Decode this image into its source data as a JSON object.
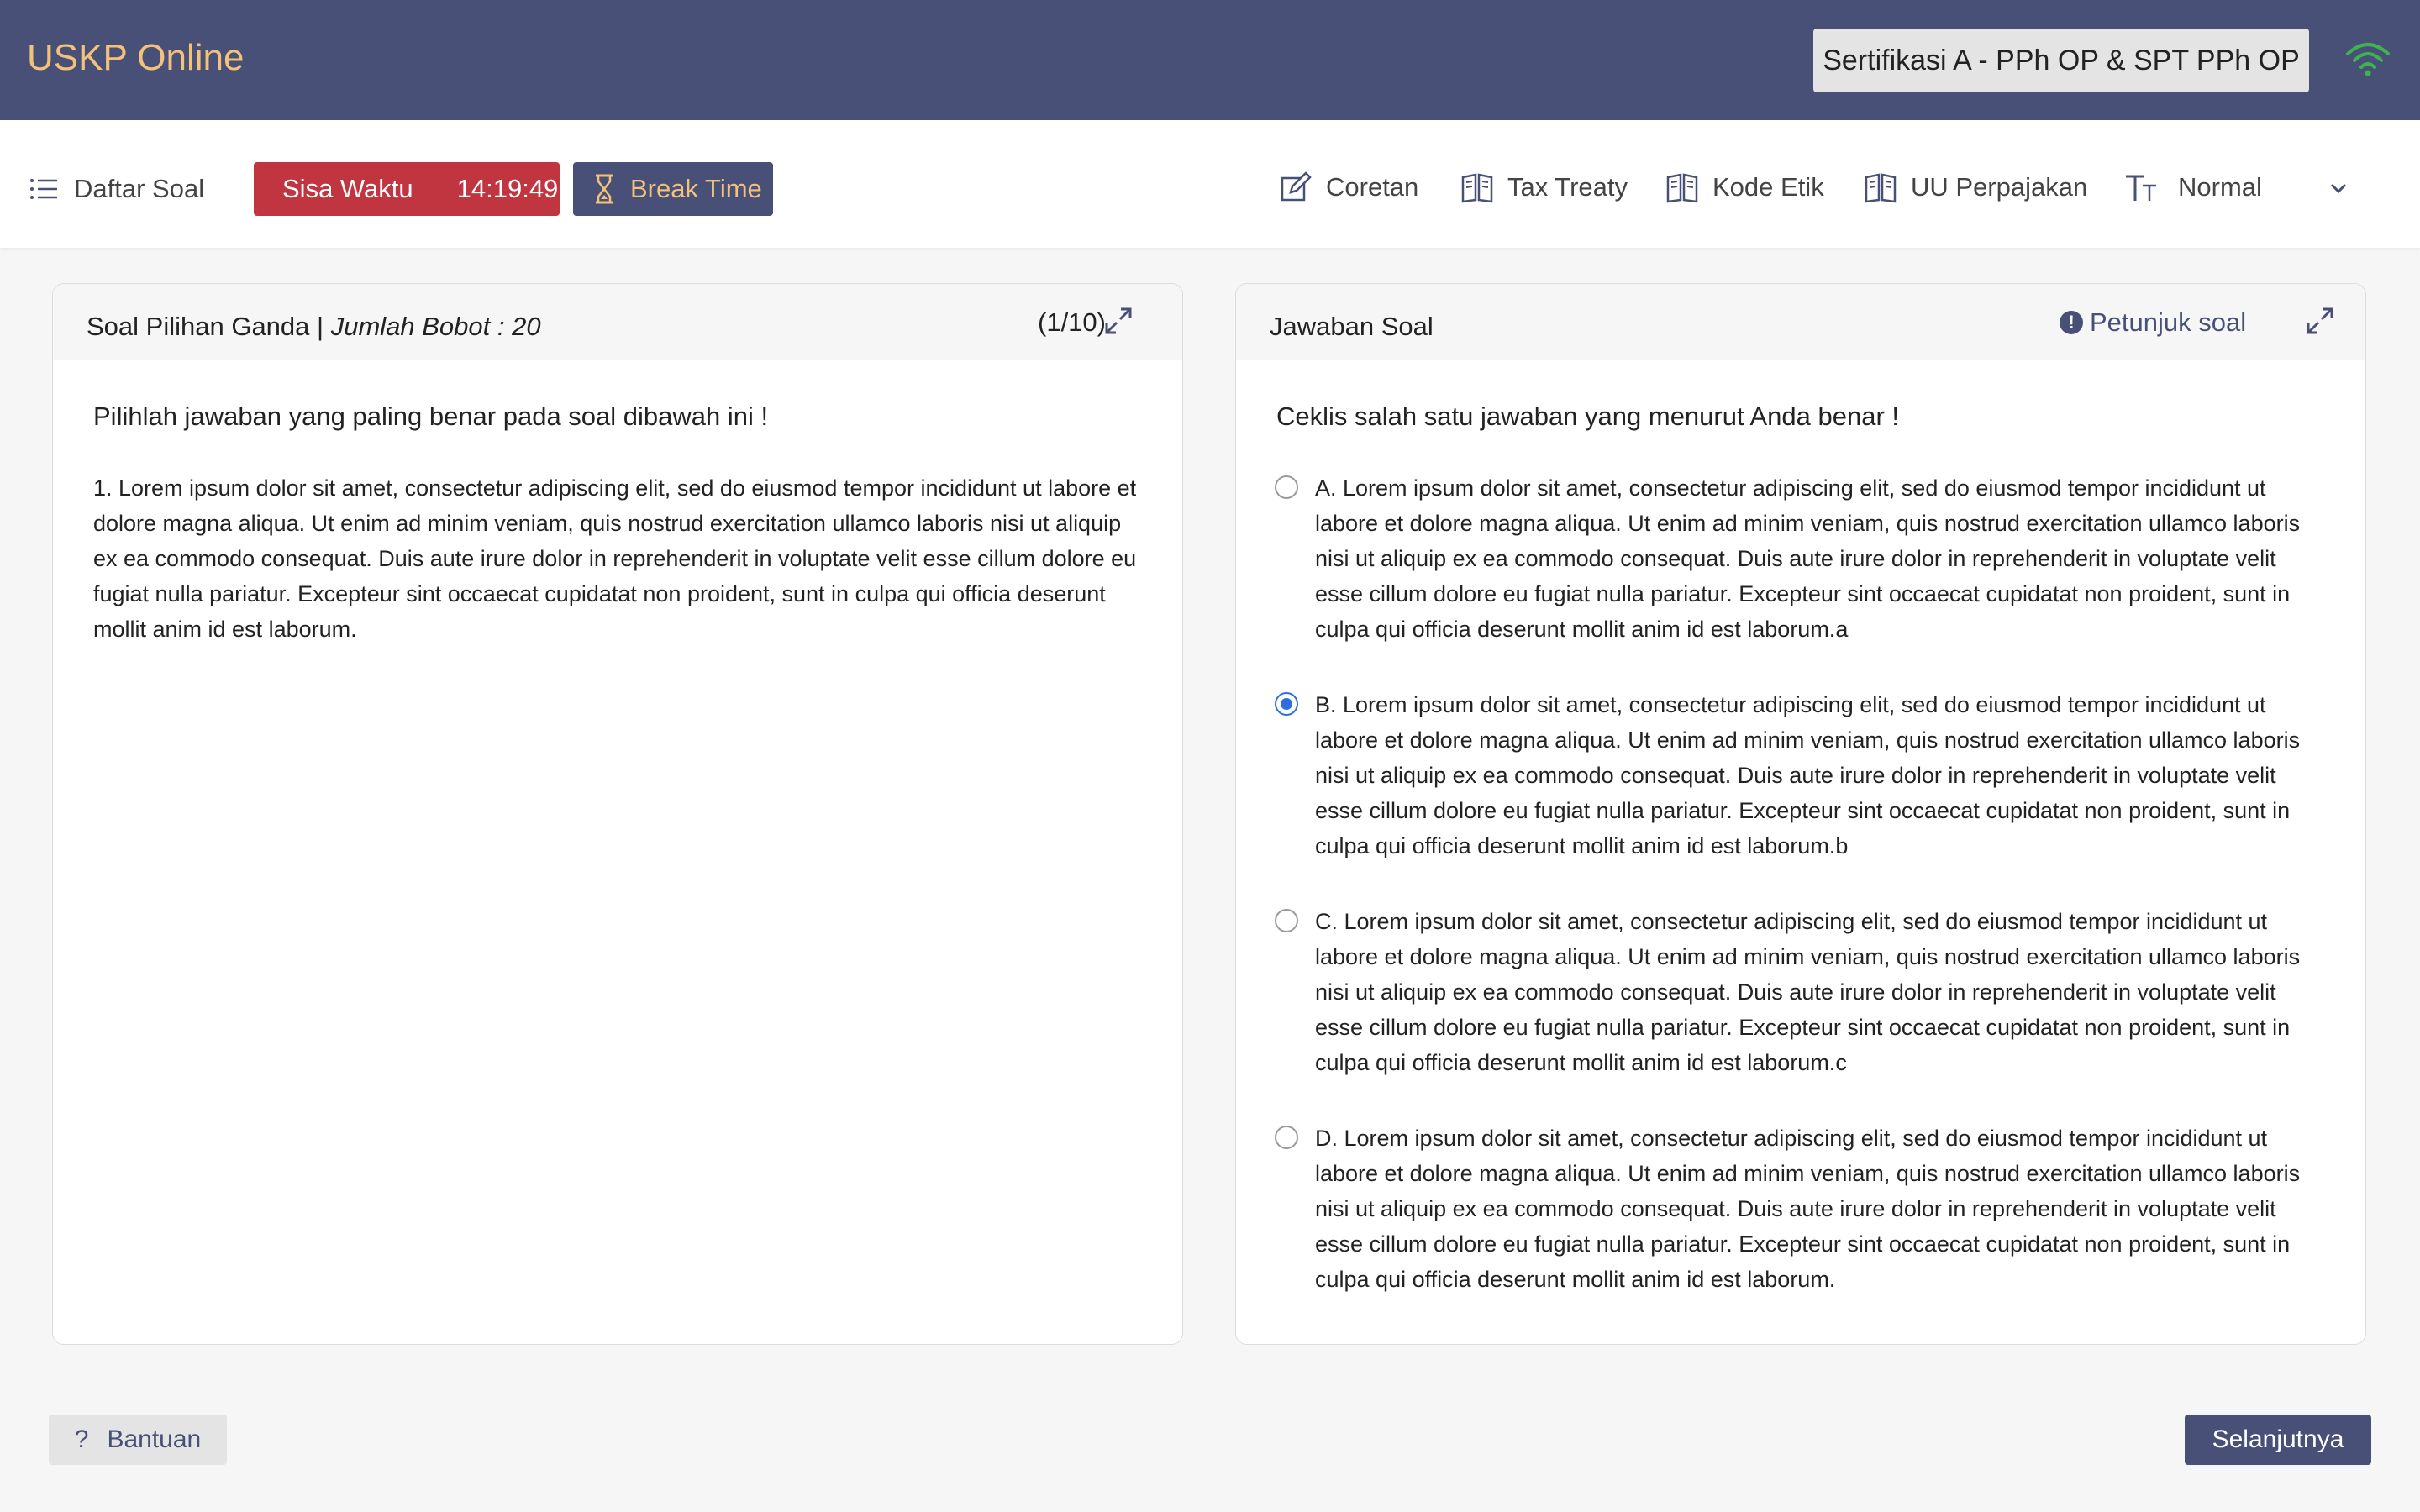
{
  "header": {
    "brand": "USKP Online",
    "certification": "Sertifikasi A - PPh OP & SPT PPh OP",
    "wifi_icon": "wifi-icon",
    "colors": {
      "bar": "#485078",
      "brand": "#f2c27a",
      "wifi": "#3fb34f"
    }
  },
  "toolbar": {
    "daftar_soal": "Daftar Soal",
    "sisa_waktu_label": "Sisa Waktu",
    "sisa_waktu_value": "14:19:49",
    "break_time": "Break Time",
    "coretan": "Coretan",
    "tax_treaty": "Tax Treaty",
    "kode_etik": "Kode Etik",
    "uu_perpajakan": "UU Perpajakan",
    "font_size": "Normal"
  },
  "question_panel": {
    "title": "Soal Pilihan Ganda |",
    "weight": "Jumlah Bobot : 20",
    "count": "(1/10)",
    "instruction": "Pilihlah jawaban yang paling benar pada soal dibawah ini !",
    "question": "1. Lorem ipsum dolor sit amet, consectetur adipiscing elit, sed do eiusmod tempor incididunt ut labore et dolore magna aliqua. Ut enim ad minim veniam, quis nostrud exercitation ullamco laboris nisi ut aliquip ex ea commodo consequat. Duis aute irure dolor in reprehenderit in voluptate velit esse cillum dolore eu fugiat nulla pariatur. Excepteur sint occaecat cupidatat non proident, sunt in culpa qui officia deserunt mollit anim id est laborum."
  },
  "answer_panel": {
    "title": "Jawaban Soal",
    "petunjuk": "Petunjuk soal",
    "instruction": "Ceklis salah satu jawaban yang menurut Anda benar !",
    "options": [
      {
        "text": "A. Lorem ipsum dolor sit amet, consectetur adipiscing elit, sed do eiusmod tempor incididunt ut labore et dolore magna aliqua. Ut enim ad minim veniam, quis nostrud exercitation ullamco laboris nisi ut aliquip ex ea commodo consequat. Duis aute irure dolor in reprehenderit in voluptate velit esse cillum dolore eu fugiat nulla pariatur. Excepteur sint occaecat cupidatat non proident, sunt in culpa qui officia deserunt mollit anim id est laborum.a",
        "selected": false
      },
      {
        "text": "B. Lorem ipsum dolor sit amet, consectetur adipiscing elit, sed do eiusmod tempor incididunt ut labore et dolore magna aliqua. Ut enim ad minim veniam, quis nostrud exercitation ullamco laboris nisi ut aliquip ex ea commodo consequat. Duis aute irure dolor in reprehenderit in voluptate velit esse cillum dolore eu fugiat nulla pariatur. Excepteur sint occaecat cupidatat non proident, sunt in culpa qui officia deserunt mollit anim id est laborum.b",
        "selected": true
      },
      {
        "text": "C. Lorem ipsum dolor sit amet, consectetur adipiscing elit, sed do eiusmod tempor incididunt ut labore et dolore magna aliqua. Ut enim ad minim veniam, quis nostrud exercitation ullamco laboris nisi ut aliquip ex ea commodo consequat. Duis aute irure dolor in reprehenderit in voluptate velit esse cillum dolore eu fugiat nulla pariatur. Excepteur sint occaecat cupidatat non proident, sunt in culpa qui officia deserunt mollit anim id est laborum.c",
        "selected": false
      },
      {
        "text": "D. Lorem ipsum dolor sit amet, consectetur adipiscing elit, sed do eiusmod tempor incididunt ut labore et dolore magna aliqua. Ut enim ad minim veniam, quis nostrud exercitation ullamco laboris nisi ut aliquip ex ea commodo consequat. Duis aute irure dolor in reprehenderit in voluptate velit esse cillum dolore eu fugiat nulla pariatur. Excepteur sint occaecat cupidatat non proident, sunt in culpa qui officia deserunt mollit anim id est laborum.",
        "selected": false
      }
    ]
  },
  "footer": {
    "bantuan_icon": "?",
    "bantuan": "Bantuan",
    "next": "Selanjutnya"
  }
}
